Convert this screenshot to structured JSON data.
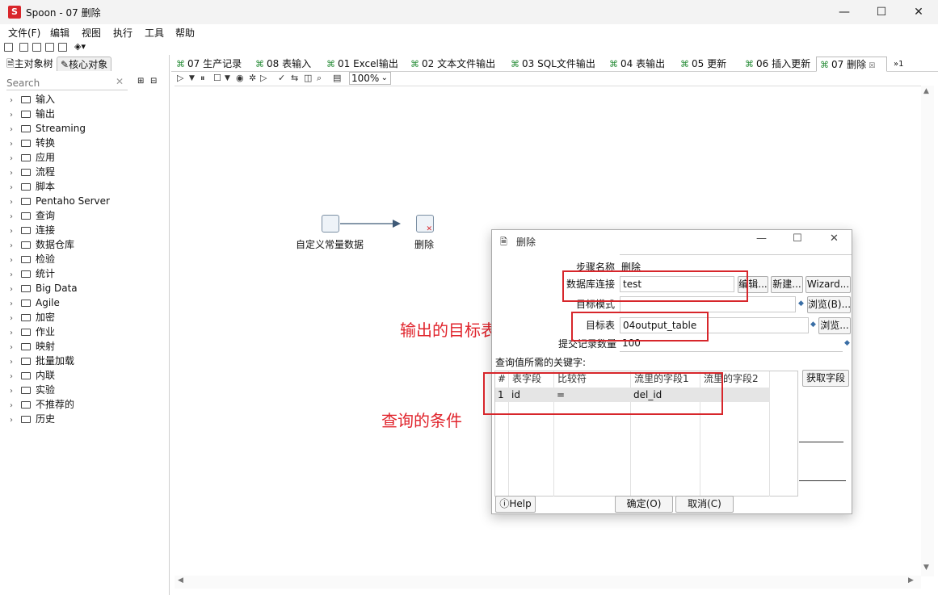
{
  "window": {
    "title": "Spoon - 07 删除",
    "app_icon_label": "S"
  },
  "menu": [
    "文件(F)",
    "编辑",
    "视图",
    "执行",
    "工具",
    "帮助"
  ],
  "left_tabs": {
    "main_tree": "主对象树",
    "core_objects": "核心对象"
  },
  "search": {
    "placeholder": "Search"
  },
  "tree": [
    "输入",
    "输出",
    "Streaming",
    "转换",
    "应用",
    "流程",
    "脚本",
    "Pentaho Server",
    "查询",
    "连接",
    "数据仓库",
    "检验",
    "统计",
    "Big Data",
    "Agile",
    "加密",
    "作业",
    "映射",
    "批量加载",
    "内联",
    "实验",
    "不推荐的",
    "历史"
  ],
  "job_tabs": [
    "07 生产记录",
    "08 表输入",
    "01 Excel输出",
    "02 文本文件输出",
    "03 SQL文件输出",
    "04 表输出",
    "05 更新",
    "06 插入更新",
    "07 删除"
  ],
  "tabs_overflow": "»1",
  "zoom": "100%",
  "steps": {
    "source": "自定义常量数据",
    "target": "删除"
  },
  "dialog": {
    "title": "删除",
    "step_name_label": "步骤名称",
    "step_name_value": "删除",
    "db_conn_label": "数据库连接",
    "db_conn_value": "test",
    "edit_btn": "编辑...",
    "new_btn": "新建...",
    "wizard_btn": "Wizard...",
    "schema_label": "目标模式",
    "browse_schema_btn": "浏览(B)...",
    "table_label": "目标表",
    "table_value": "04output_table",
    "browse_table_btn": "浏览...",
    "commit_label": "提交记录数量",
    "commit_value": "100",
    "keys_label": "查询值所需的关键字:",
    "get_fields_btn": "获取字段",
    "grid_headers": [
      "#",
      "表字段",
      "比较符",
      "流里的字段1",
      "流里的字段2"
    ],
    "grid_rows": [
      [
        "1",
        "id",
        "=",
        "del_id",
        ""
      ]
    ],
    "help_btn": "Help",
    "ok_btn": "确定(O)",
    "cancel_btn": "取消(C)"
  },
  "annotations": {
    "target_table": "输出的目标表",
    "query_condition": "查询的条件"
  }
}
